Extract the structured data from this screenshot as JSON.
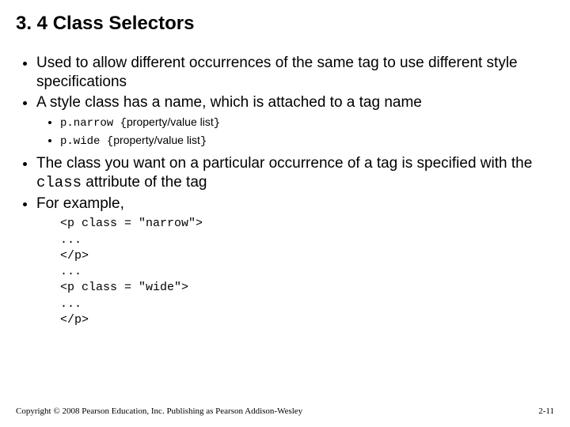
{
  "title": "3. 4 Class Selectors",
  "bullets": {
    "b1": "Used to allow different occurrences of the same tag to use different style specifications",
    "b2": "A style class has a name, which is attached to a tag name",
    "sub1_code": "p.narrow {",
    "sub1_text": "property/value list",
    "sub1_close": "}",
    "sub2_code": "p.wide {",
    "sub2_text": "property/value list",
    "sub2_close": "}",
    "b3_a": "The class you want on a particular occurrence of a tag is specified with the ",
    "b3_code": "class",
    "b3_b": " attribute of the tag",
    "b4": "For example,"
  },
  "codeblock": "<p class = \"narrow\">\n...\n</p>\n...\n<p class = \"wide\">\n...\n</p>",
  "footer": {
    "copyright": "Copyright © 2008 Pearson Education, Inc. Publishing as Pearson Addison-Wesley",
    "pagenum": "2-11"
  }
}
